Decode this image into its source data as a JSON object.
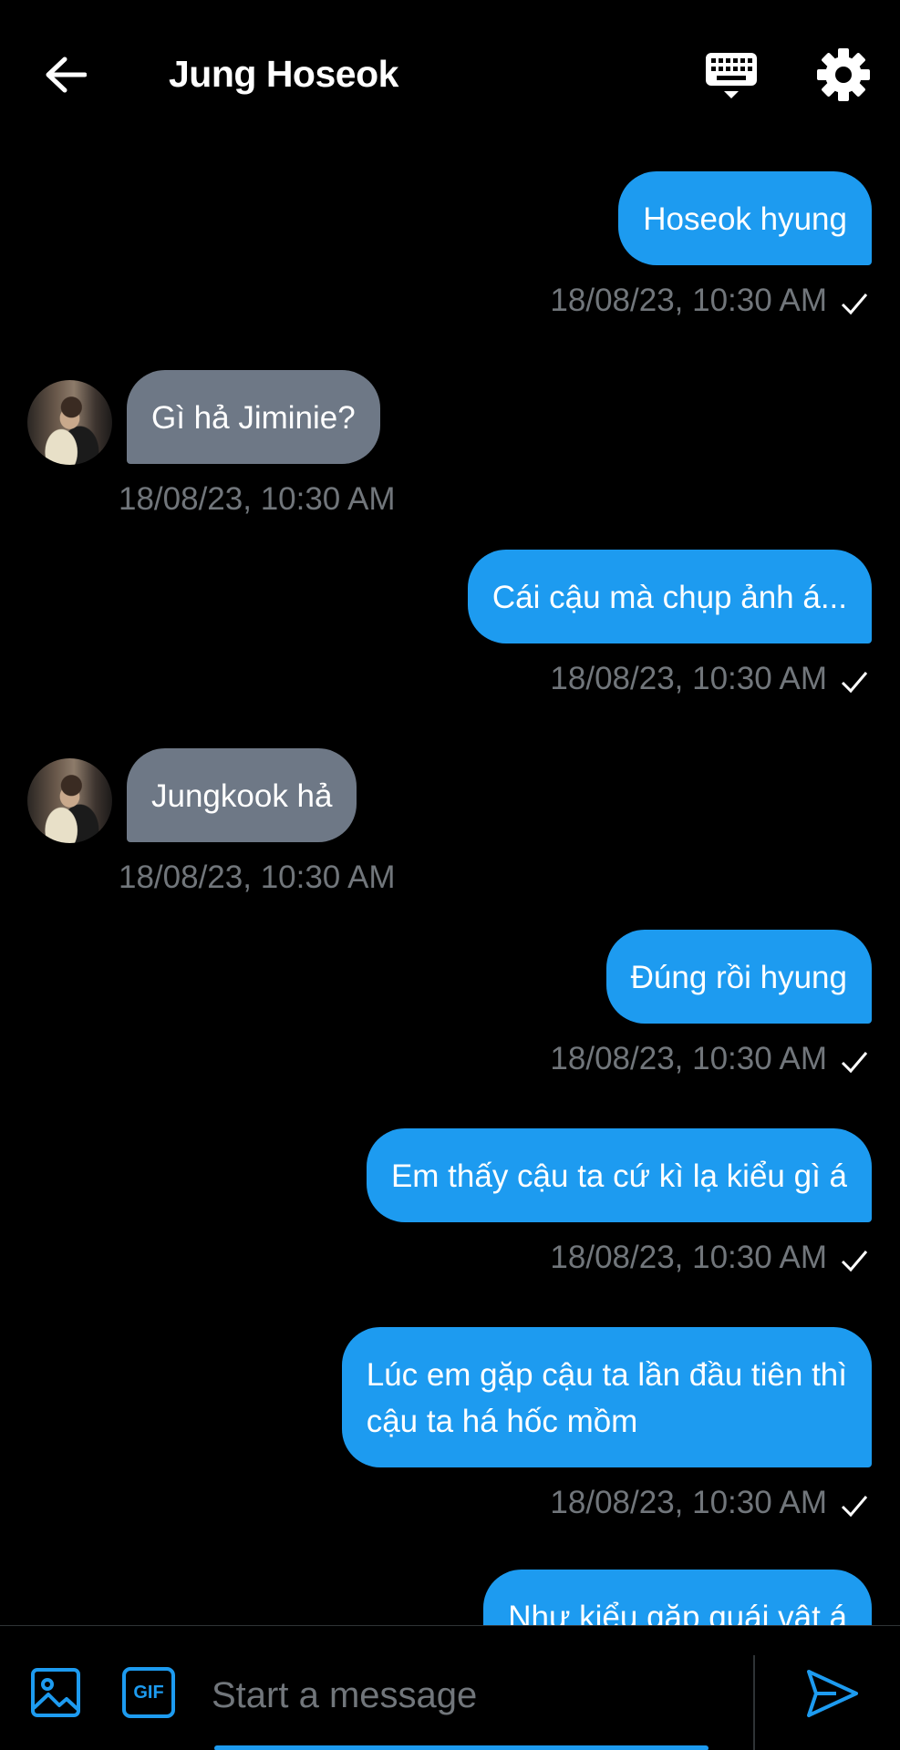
{
  "header": {
    "title": "Jung Hoseok",
    "back_icon": "arrow-left-icon",
    "keyboard_icon": "keyboard-icon",
    "settings_icon": "gear-icon"
  },
  "messages": [
    {
      "direction": "out",
      "text": "Hoseok hyung",
      "time": "18/08/23, 10:30 AM",
      "read": true
    },
    {
      "direction": "in",
      "text": "Gì hả Jiminie?",
      "time": "18/08/23, 10:30 AM"
    },
    {
      "direction": "out",
      "text": "Cái cậu mà chụp ảnh á...",
      "time": "18/08/23, 10:30 AM",
      "read": true
    },
    {
      "direction": "in",
      "text": "Jungkook hả",
      "time": "18/08/23, 10:30 AM"
    },
    {
      "direction": "out",
      "text": "Đúng rồi hyung",
      "time": "18/08/23, 10:30 AM",
      "read": true
    },
    {
      "direction": "out",
      "text": "Em thấy cậu ta cứ kì lạ kiểu gì á",
      "time": "18/08/23, 10:30 AM",
      "read": true
    },
    {
      "direction": "out",
      "text": "Lúc em gặp cậu ta lần đầu tiên thì\ncậu ta  há hốc mồm",
      "time": "18/08/23, 10:30 AM",
      "read": true
    },
    {
      "direction": "out",
      "text": "Như kiểu gặp quái vật á",
      "time": "",
      "read": false
    }
  ],
  "composer": {
    "placeholder": "Start a message",
    "value": "",
    "image_icon": "image-icon",
    "gif_label": "GIF",
    "send_icon": "send-icon"
  },
  "colors": {
    "background": "#000000",
    "outgoing_bubble": "#1d9bf0",
    "incoming_bubble": "#6e7886",
    "timestamp": "#71767b",
    "accent": "#1d9bf0"
  }
}
